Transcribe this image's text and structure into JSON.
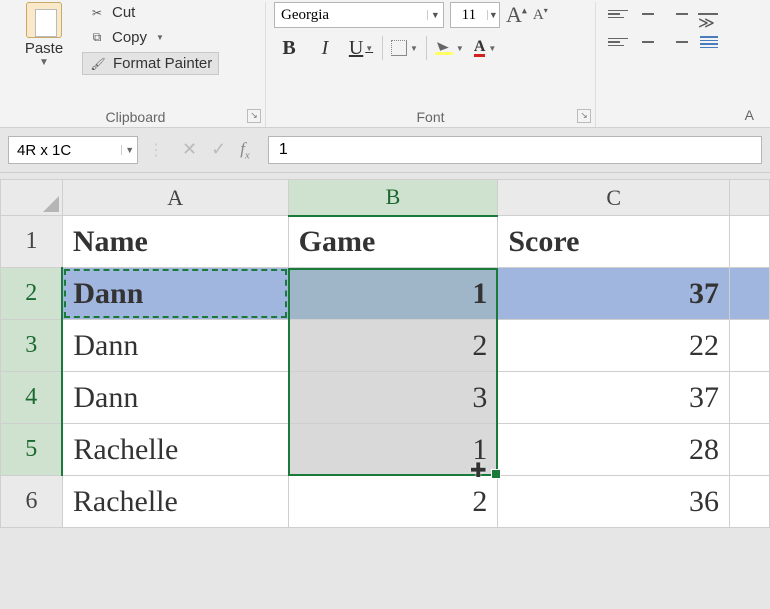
{
  "ribbon": {
    "clipboard": {
      "paste_label": "Paste",
      "cut_label": "Cut",
      "copy_label": "Copy",
      "format_painter_label": "Format Painter",
      "group_label": "Clipboard"
    },
    "font": {
      "font_name": "Georgia",
      "font_size": "11",
      "group_label": "Font"
    },
    "alignment": {
      "partial_label": "A"
    }
  },
  "formula_bar": {
    "name_box": "4R x 1C",
    "formula_value": "1"
  },
  "columns": [
    "A",
    "B",
    "C"
  ],
  "row_numbers": [
    "1",
    "2",
    "3",
    "4",
    "5",
    "6"
  ],
  "headers": {
    "A": "Name",
    "B": "Game",
    "C": "Score"
  },
  "rows": [
    {
      "name": "Dann",
      "game": "1",
      "score": "37"
    },
    {
      "name": "Dann",
      "game": "2",
      "score": "22"
    },
    {
      "name": "Dann",
      "game": "3",
      "score": "37"
    },
    {
      "name": "Rachelle",
      "game": "1",
      "score": "28"
    },
    {
      "name": "Rachelle",
      "game": "2",
      "score": "36"
    }
  ],
  "selection": {
    "copied_cell": "A2",
    "range": "B2:B5",
    "highlighted_row": 2
  }
}
